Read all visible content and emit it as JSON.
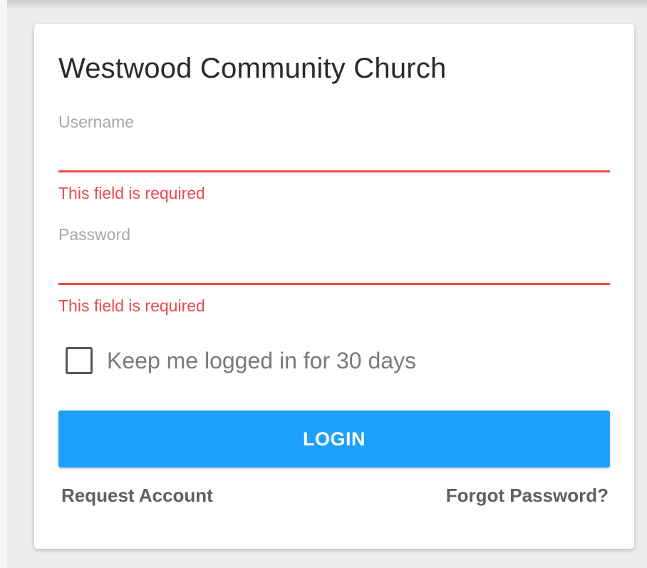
{
  "card": {
    "title": "Westwood Community Church"
  },
  "username": {
    "label": "Username",
    "value": "",
    "error": "This field is required"
  },
  "password": {
    "label": "Password",
    "value": "",
    "error": "This field is required"
  },
  "remember": {
    "label": "Keep me logged in for 30 days",
    "checked": false
  },
  "actions": {
    "login_label": "LOGIN",
    "request_account_label": "Request Account",
    "forgot_password_label": "Forgot Password?"
  },
  "colors": {
    "accent": "#1ea0ff",
    "error": "#ec4a4a",
    "label": "#a8a8a8",
    "link": "#5f5f5f",
    "title": "#2a2a2a"
  }
}
